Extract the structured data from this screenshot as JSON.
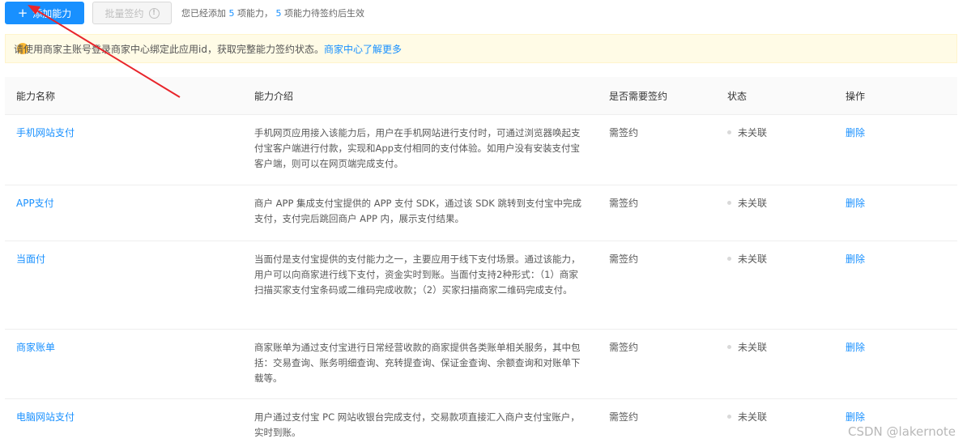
{
  "toolbar": {
    "add_label": "添加能力",
    "add_plus": "+",
    "batch_label": "批量签约",
    "summary_prefix": "您已经添加",
    "summary_added": "5",
    "summary_mid": "项能力，",
    "summary_pending": "5",
    "summary_suffix": "项能力待签约后生效"
  },
  "notice": {
    "text": "请使用商家主账号登录商家中心绑定此应用id，获取完整能力签约状态。",
    "link": "商家中心",
    "link2": "了解更多"
  },
  "table": {
    "headers": [
      "能力名称",
      "能力介绍",
      "是否需要签约",
      "状态",
      "操作"
    ],
    "rows": [
      {
        "name": "手机网站支付",
        "desc": "手机网页应用接入该能力后，用户在手机网站进行支付时，可通过浏览器唤起支付宝客户端进行付款，实现和App支付相同的支付体验。如用户没有安装支付宝客户端，则可以在网页端完成支付。",
        "sign": "需签约",
        "status": "未关联",
        "op": "删除"
      },
      {
        "name": "APP支付",
        "desc": "商户 APP 集成支付宝提供的 APP 支付 SDK，通过该 SDK 跳转到支付宝中完成支付，支付完后跳回商户 APP 内，展示支付结果。",
        "sign": "需签约",
        "status": "未关联",
        "op": "删除"
      },
      {
        "name": "当面付",
        "desc": "当面付是支付宝提供的支付能力之一，主要应用于线下支付场景。通过该能力，用户可以向商家进行线下支付，资金实时到账。当面付支持2种形式：（1）商家扫描买家支付宝条码或二维码完成收款；（2）买家扫描商家二维码完成支付。",
        "sign": "需签约",
        "status": "未关联",
        "op": "删除"
      },
      {
        "name": "商家账单",
        "desc": "商家账单为通过支付宝进行日常经营收款的商家提供各类账单相关服务，其中包括：交易查询、账务明细查询、充转提查询、保证金查询、余额查询和对账单下载等。",
        "sign": "需签约",
        "status": "未关联",
        "op": "删除"
      },
      {
        "name": "电脑网站支付",
        "desc": "用户通过支付宝 PC 网站收银台完成支付，交易款项直接汇入商户支付宝账户，实时到账。",
        "sign": "需签约",
        "status": "未关联",
        "op": "删除"
      }
    ]
  },
  "watermark": "CSDN @lakernote",
  "colors": {
    "accent": "#1890ff",
    "arrow": "#e8252b",
    "notice_bg": "#fffbe6"
  }
}
